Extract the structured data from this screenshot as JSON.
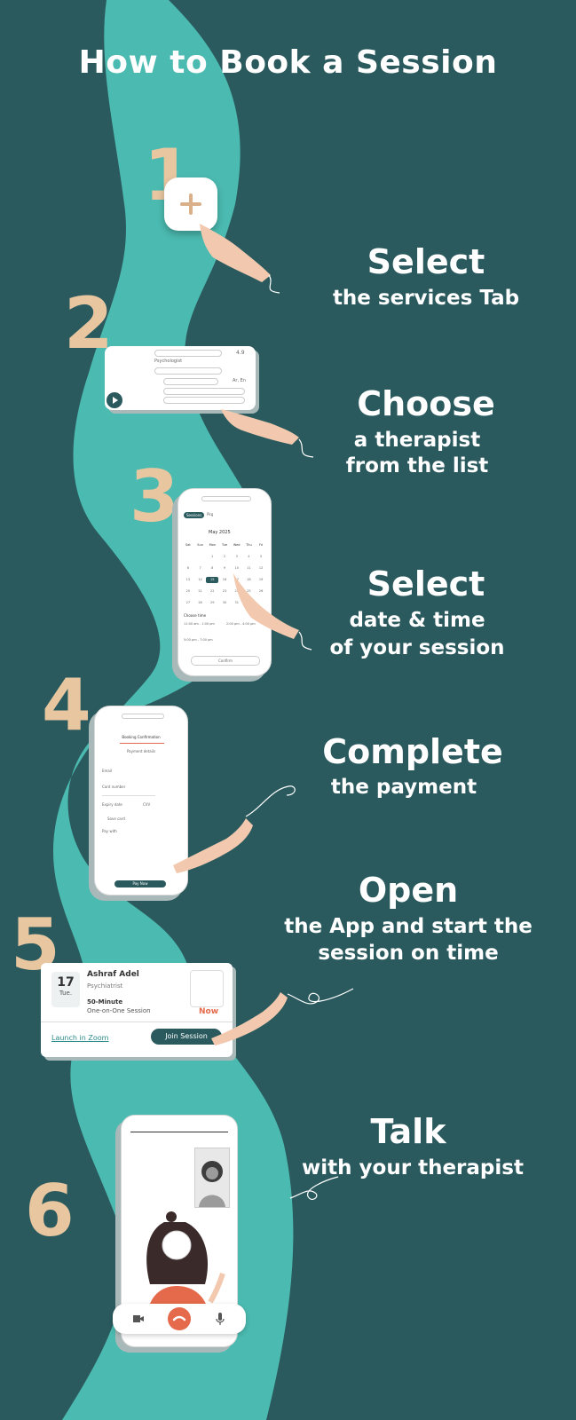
{
  "title": "How to Book a Session",
  "steps": [
    {
      "number": "1",
      "heading": "Select",
      "subtitle": "the services Tab",
      "icon": "plus-icon"
    },
    {
      "number": "2",
      "heading": "Choose",
      "subtitle_lines": [
        "a therapist",
        "from the list"
      ],
      "card": {
        "rating": "4.9",
        "role": "Psychologist",
        "languages": "Ar, En"
      }
    },
    {
      "number": "3",
      "heading": "Select",
      "subtitle_lines": [
        "date & time",
        "of your session"
      ],
      "calendar": {
        "tab1": "Sessions",
        "tab2": "Pkg",
        "month": "May 2025",
        "weekdays": [
          "Sat",
          "Sun",
          "Mon",
          "Tue",
          "Wed",
          "Thu",
          "Fri"
        ],
        "days": [
          "",
          "",
          "1",
          "2",
          "3",
          "4",
          "5",
          "6",
          "7",
          "8",
          "9",
          "10",
          "11",
          "12",
          "13",
          "14",
          "15",
          "16",
          "17",
          "18",
          "19",
          "20",
          "21",
          "22",
          "23",
          "24",
          "25",
          "26",
          "27",
          "28",
          "29",
          "30",
          "31",
          "",
          ""
        ],
        "selected_day": "15",
        "slot_title": "Choose time",
        "slots": [
          "11:00 am - 1:00 pm",
          "2:00 pm - 4:00 pm",
          "5:00 pm - 7:00 pm"
        ],
        "button": "Confirm"
      }
    },
    {
      "number": "4",
      "heading": "Complete",
      "subtitle": "the payment",
      "payment": {
        "header": "Booking Confirmation",
        "tab": "Payment details",
        "field1": "Email",
        "field2": "Card number",
        "field3": "Expiry date",
        "field4": "CVV",
        "remember": "Save card",
        "pay_with": "Pay with",
        "button": "Pay Now"
      }
    },
    {
      "number": "5",
      "heading": "Open",
      "subtitle_lines": [
        "the App and start the",
        "session on time"
      ],
      "session": {
        "day": "17",
        "weekday": "Tue.",
        "name": "Ashraf Adel",
        "role": "Psychiatrist",
        "duration": "50-Minute",
        "type": "One-on-One Session",
        "status": "Now",
        "link": "Launch in Zoom",
        "button": "Join Session"
      }
    },
    {
      "number": "6",
      "heading": "Talk",
      "subtitle": "with your therapist",
      "call_icons": [
        "video-icon",
        "end-call-icon",
        "mic-icon"
      ]
    }
  ],
  "colors": {
    "background": "#2b5a5e",
    "river": "#4bbab0",
    "number": "#e7c6a0",
    "hand": "#f2c9ae",
    "accent": "#e56a4b"
  }
}
